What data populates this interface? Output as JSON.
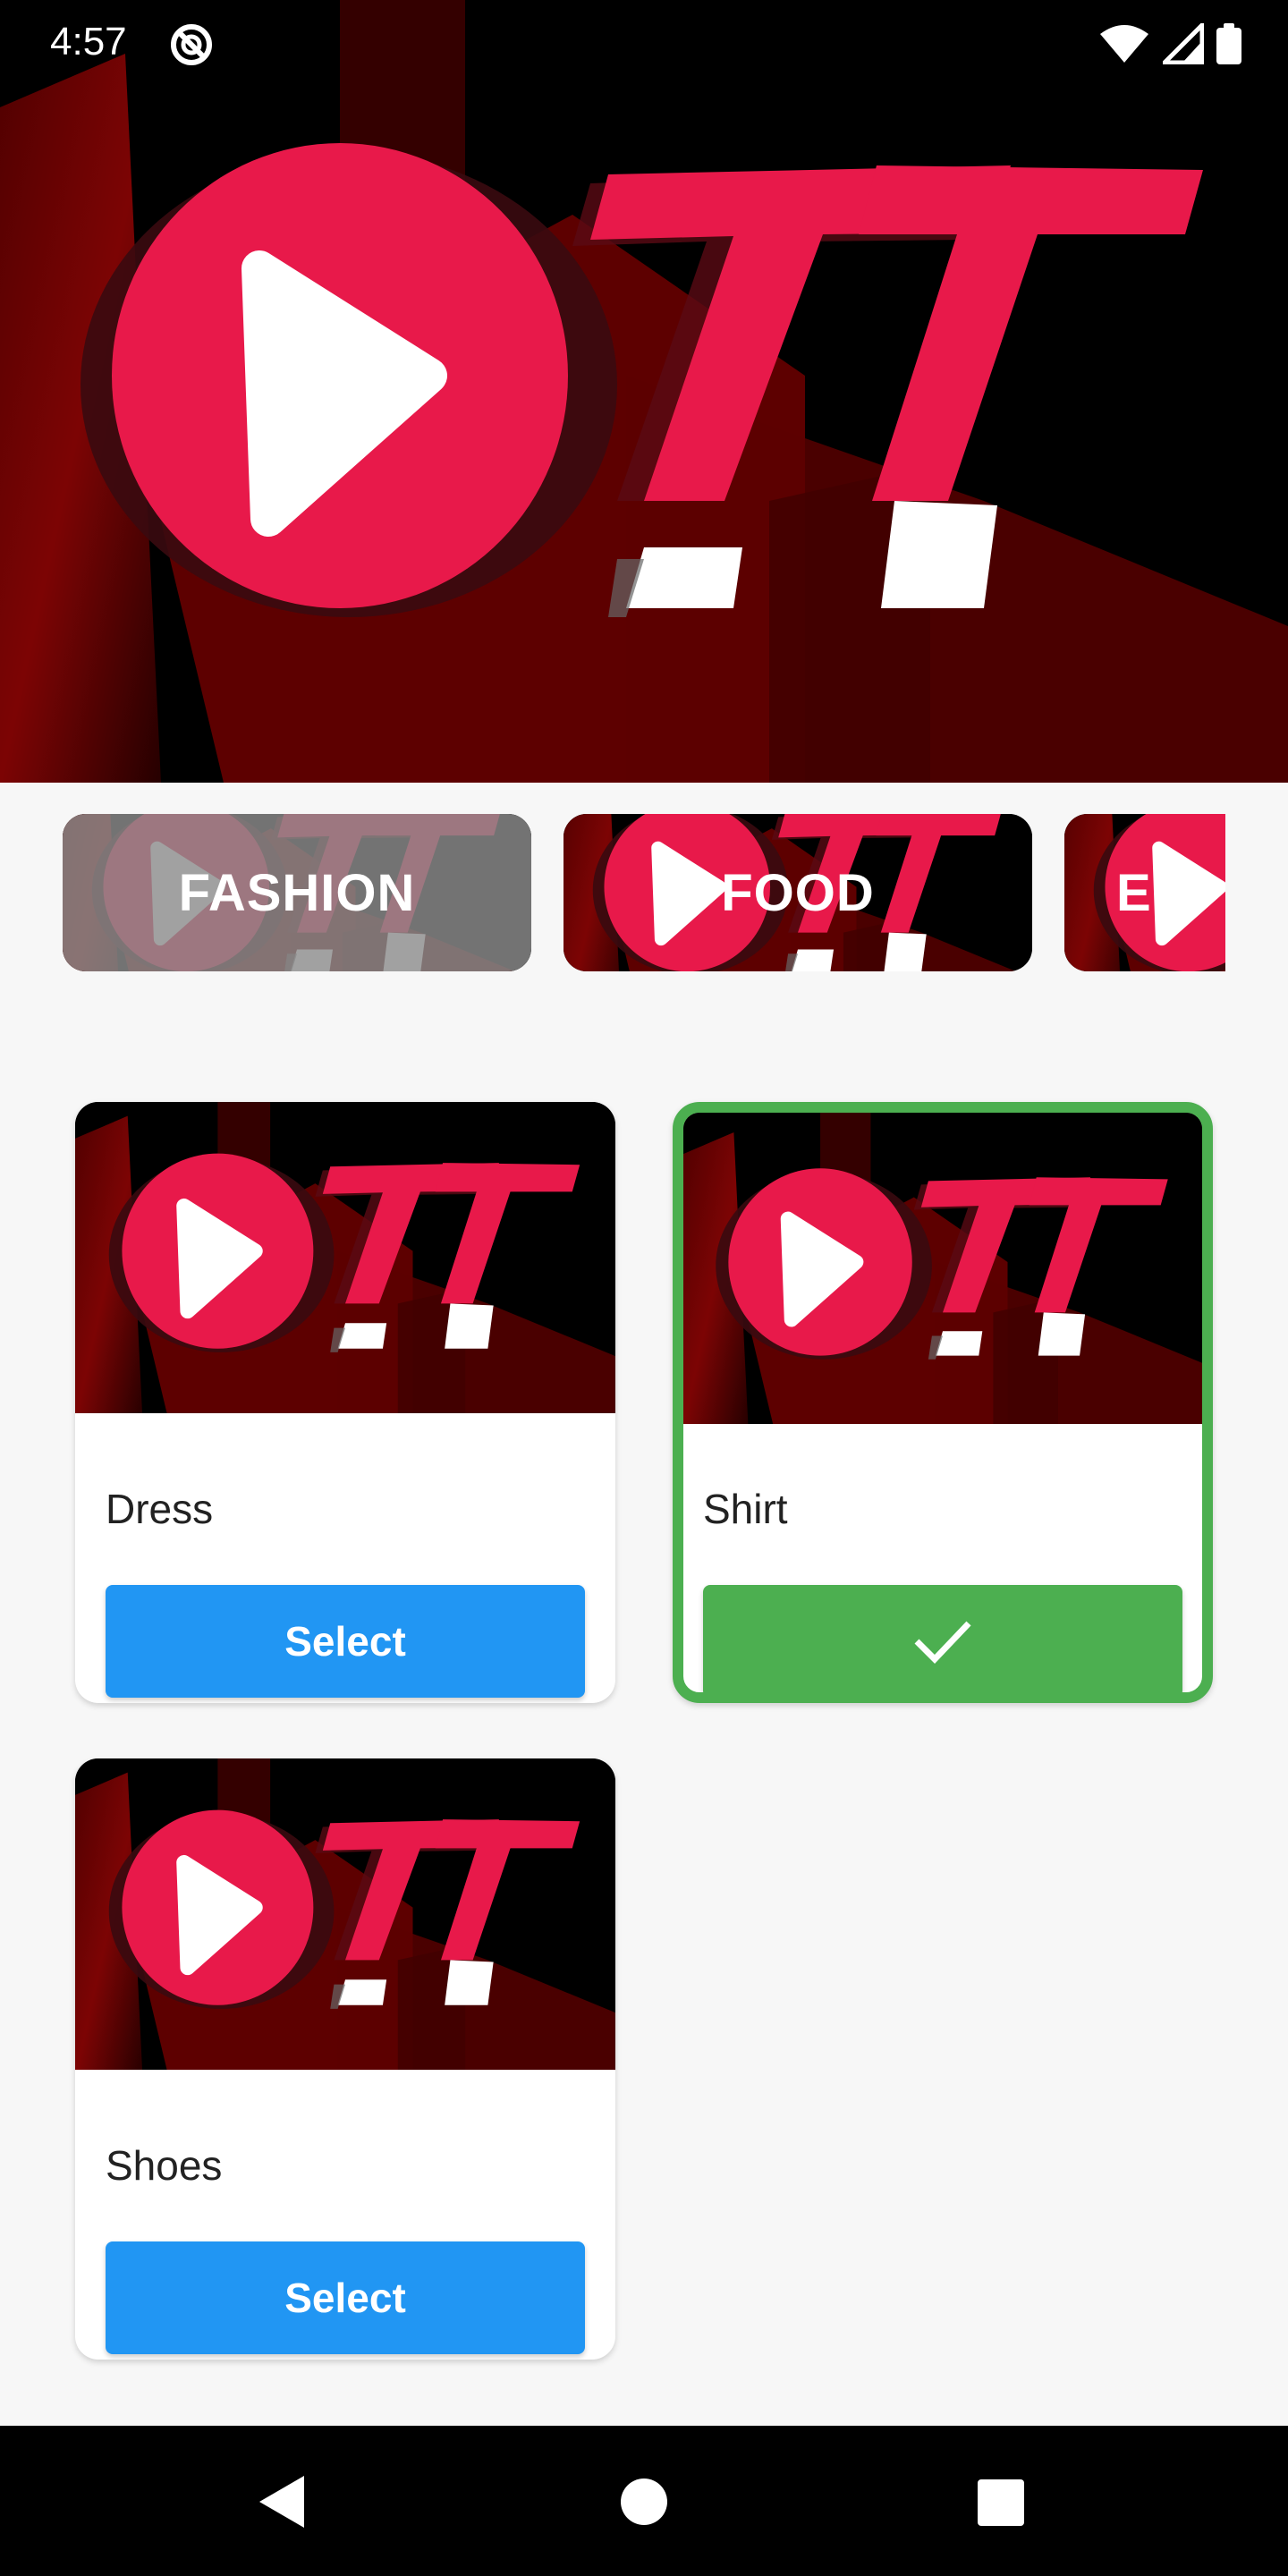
{
  "status_bar": {
    "time": "4:57",
    "icons": [
      "do-not-disturb-icon",
      "wifi-icon",
      "cellular-signal-icon",
      "battery-icon"
    ]
  },
  "hero": {
    "logo_name": "ott-logo"
  },
  "categories": [
    {
      "label": "FASHION",
      "state": "inactive"
    },
    {
      "label": "FOOD",
      "state": "active"
    },
    {
      "label": "EN",
      "state": "active"
    }
  ],
  "products": [
    {
      "name": "Dress",
      "button_label": "Select",
      "selected": false
    },
    {
      "name": "Shirt",
      "button_label": "",
      "selected": true,
      "button_icon": "check-icon"
    },
    {
      "name": "Shoes",
      "button_label": "Select",
      "selected": false
    }
  ],
  "colors": {
    "brand_red": "#e8194a",
    "select_blue": "#2196f3",
    "selected_green": "#4caf50",
    "background": "#f7f7f7"
  },
  "nav_bar": {
    "icons": [
      "back-icon",
      "home-icon",
      "recents-icon"
    ]
  }
}
